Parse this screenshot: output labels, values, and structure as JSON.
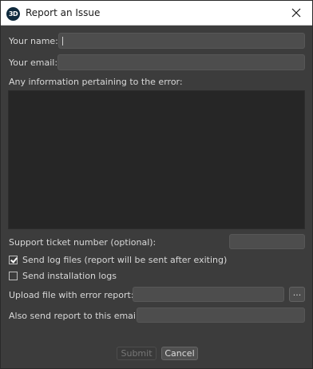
{
  "window": {
    "title": "Report an Issue",
    "app_icon_text": "3D",
    "close_icon": "close-icon"
  },
  "form": {
    "name_label": "Your name:",
    "name_value": "",
    "email_label": "Your email:",
    "email_value": "",
    "info_label": "Any information pertaining to the error:",
    "info_value": "",
    "ticket_label": "Support ticket number (optional):",
    "ticket_value": "",
    "send_logs_label": "Send log files (report will be sent after exiting)",
    "send_logs_checked": true,
    "send_install_logs_label": "Send installation logs",
    "send_install_logs_checked": false,
    "upload_label": "Upload file with error report:",
    "upload_value": "",
    "browse_label": "...",
    "also_send_label": "Also send report to this email:",
    "also_send_value": ""
  },
  "buttons": {
    "submit_label": "Submit",
    "cancel_label": "Cancel"
  },
  "colors": {
    "background": "#3c3c3c",
    "field": "#4d4d4d",
    "textarea": "#262626",
    "titlebar": "#ffffff"
  }
}
